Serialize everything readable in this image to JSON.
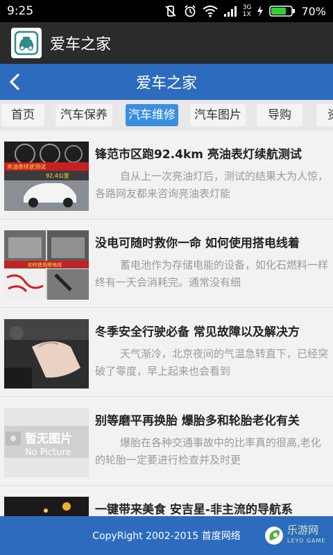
{
  "status_bar": {
    "time": "9:25",
    "network": "3G",
    "network_sub": "1X",
    "battery": "70%"
  },
  "app_bar": {
    "title": "爱车之家"
  },
  "header": {
    "title": "爱车之家"
  },
  "tabs": [
    "首页",
    "汽车保养",
    "汽车维修",
    "汽车图片",
    "导购",
    "资"
  ],
  "active_tab": "汽车维修",
  "articles": [
    {
      "title": "锋范市区跑92.4km 亮油表灯续航测试",
      "desc": "自从上一次亮油灯后，测试的结果大为人惊，各路网友都来咨询亮油表灯能"
    },
    {
      "title": "没电可随时救你一命 如何使用搭电线着",
      "desc": "蓄电池作为存储电能的设备，如化石燃料一样终有一天会消耗完。通常没有细"
    },
    {
      "title": "冬季安全行驶必备 常见故障以及解决方",
      "desc": "天气渐冷，北京夜间的气温急转直下，已经突破了零度，早上起来也会看到"
    },
    {
      "title": "别等磨平再换胎 爆胎多和轮胎老化有关",
      "desc": "爆胎在各种交通事故中的比率真的很高,老化的轮胎一定要进行检查并及时更"
    },
    {
      "title": "一键带来美食 安吉星-非主流的导航系",
      "desc": ""
    }
  ],
  "thumb_texts": {
    "t1_banner": "亮油表续驶测试",
    "t1_sub": "92.4公里",
    "t2_banner": "如何使用搭电线",
    "placeholder_line1": "暂无图片",
    "placeholder_line2": "No Picture"
  },
  "footer": {
    "copyright": "CopyRight 2002-2015 首度网络",
    "watermark": "乐游网",
    "watermark_sub": "LEYO GAME"
  }
}
